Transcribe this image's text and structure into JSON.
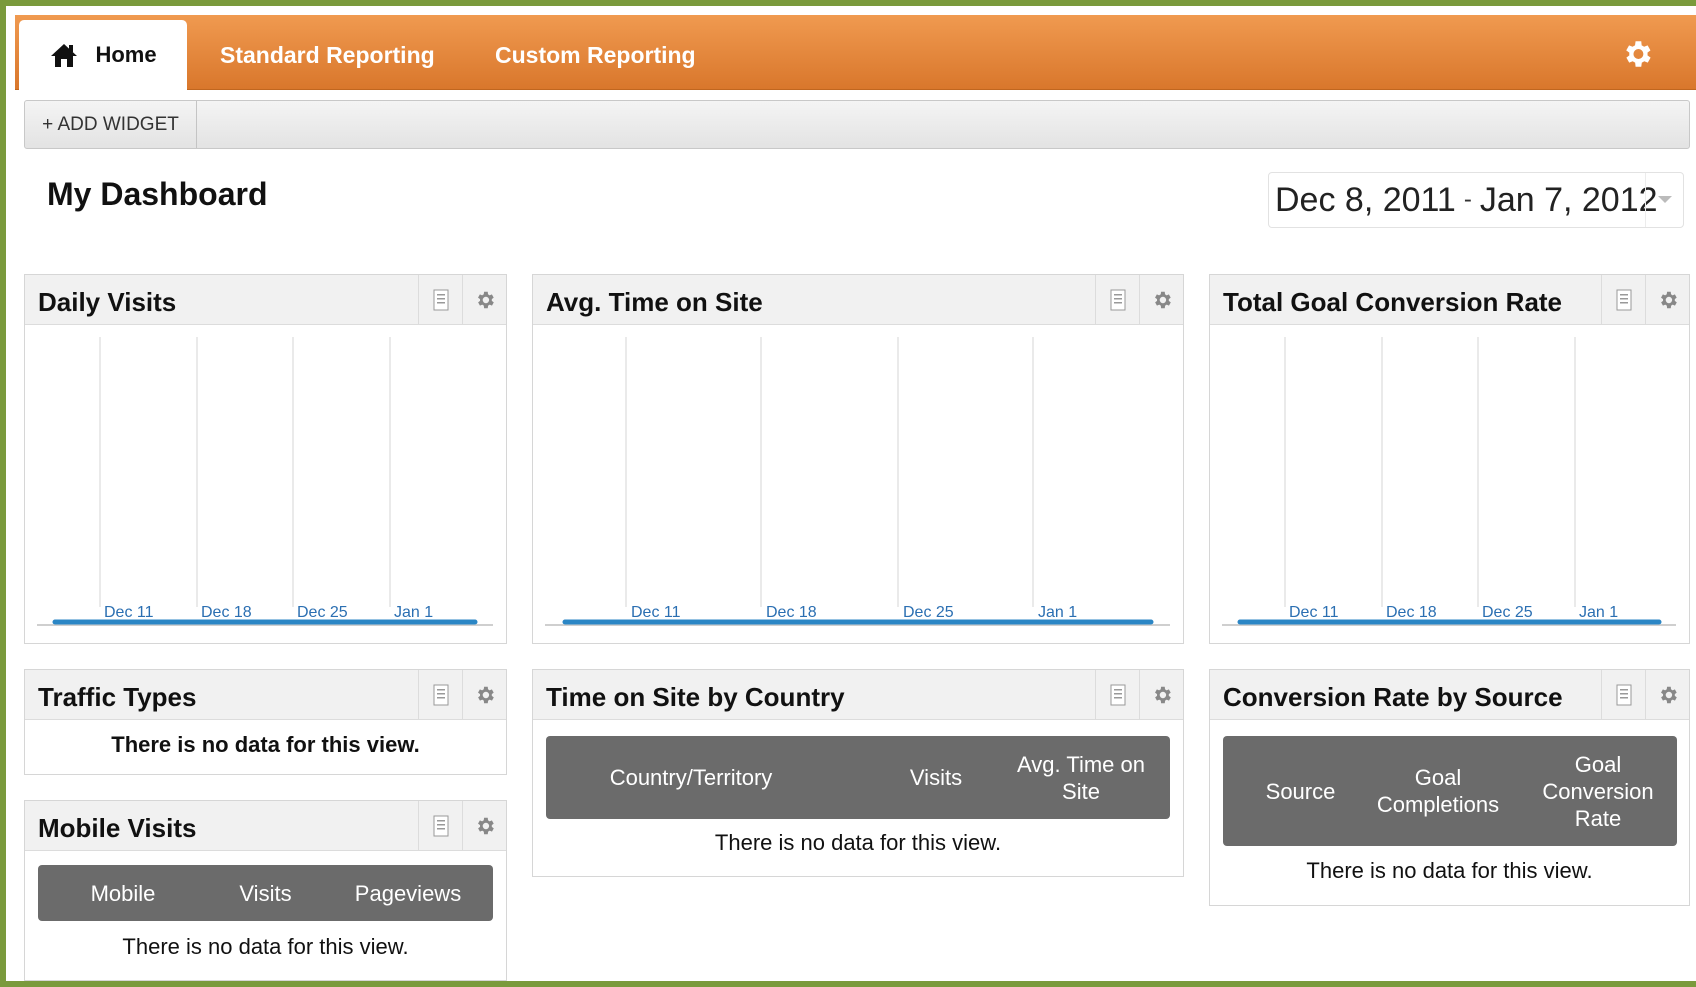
{
  "nav": {
    "tabs": [
      {
        "label": "Home"
      },
      {
        "label": "Standard Reporting"
      },
      {
        "label": "Custom Reporting"
      }
    ],
    "settings_icon": "gear-icon",
    "color": "#e3823a"
  },
  "toolbar": {
    "add_widget_label": "+ ADD WIDGET"
  },
  "dashboard": {
    "title": "My Dashboard",
    "date_start": "Dec 8, 2011",
    "date_separator": "-",
    "date_end": "Jan 7, 2012"
  },
  "widgets": {
    "daily_visits": {
      "title": "Daily Visits",
      "ticks": [
        "Dec 11",
        "Dec 18",
        "Dec 25",
        "Jan 1"
      ]
    },
    "avg_time": {
      "title": "Avg. Time on Site",
      "ticks": [
        "Dec 11",
        "Dec 18",
        "Dec 25",
        "Jan 1"
      ]
    },
    "goal_conversion": {
      "title": "Total Goal Conversion Rate",
      "ticks": [
        "Dec 11",
        "Dec 18",
        "Dec 25",
        "Jan 1"
      ]
    },
    "traffic_types": {
      "title": "Traffic Types",
      "message": "There is no data for this view."
    },
    "mobile_visits": {
      "title": "Mobile Visits",
      "columns": [
        "Mobile",
        "Visits",
        "Pageviews"
      ],
      "message": "There is no data for this view."
    },
    "time_by_country": {
      "title": "Time on Site by Country",
      "columns": [
        "Country/Territory",
        "Visits",
        "Avg. Time on Site"
      ],
      "message": "There is no data for this view."
    },
    "conversion_by_source": {
      "title": "Conversion Rate by Source",
      "columns": [
        "Source",
        "Goal Completions",
        "Goal Conversion Rate"
      ],
      "message": "There is no data for this view."
    }
  },
  "colors": {
    "line": "#2b86c5",
    "tick_text": "#2b6fb2",
    "table_header": "#6b6b6b"
  }
}
